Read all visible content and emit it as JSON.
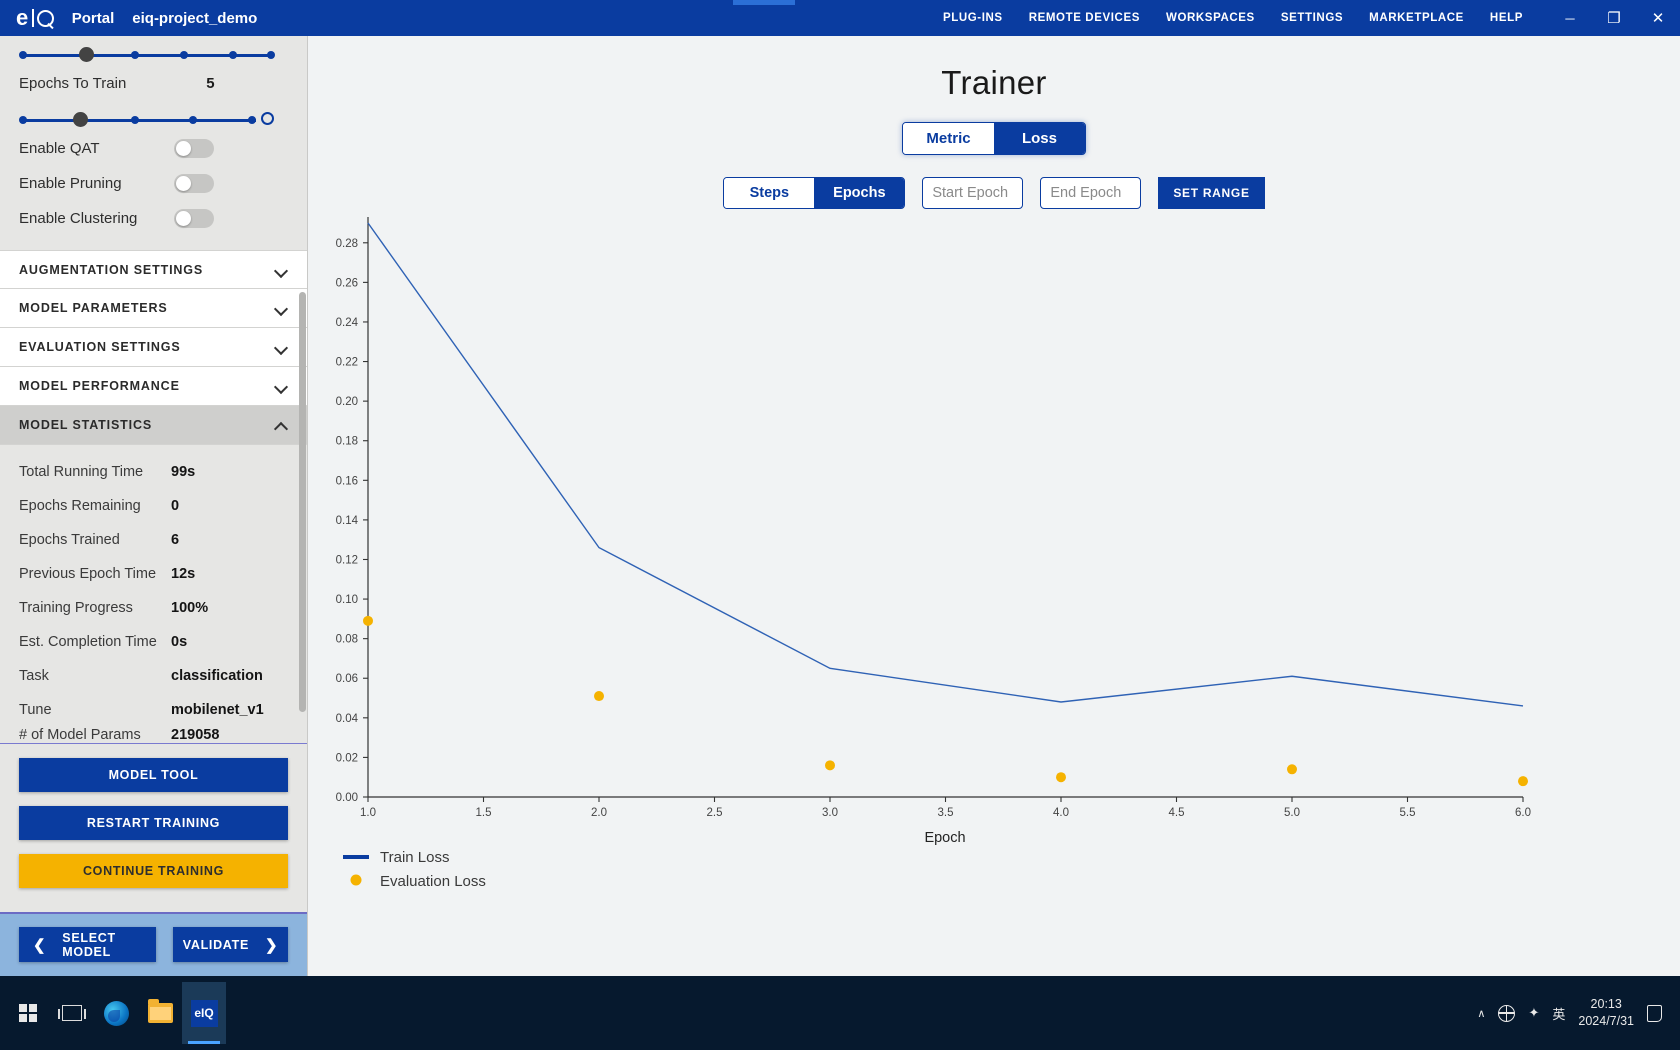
{
  "titlebar": {
    "logo": "eiq-logo",
    "portal_label": "Portal",
    "project_name": "eiq-project_demo",
    "nav": [
      {
        "label": "PLUG-INS"
      },
      {
        "label": "REMOTE DEVICES"
      },
      {
        "label": "WORKSPACES"
      },
      {
        "label": "SETTINGS"
      },
      {
        "label": "MARKETPLACE"
      },
      {
        "label": "HELP"
      }
    ],
    "window_controls": {
      "minimize": "─",
      "maximize": "❐",
      "close": "✕"
    }
  },
  "sidebar": {
    "epochs_to_train": {
      "label": "Epochs To Train",
      "value": "5"
    },
    "toggles": [
      {
        "label": "Enable QAT",
        "state": "off"
      },
      {
        "label": "Enable Pruning",
        "state": "off"
      },
      {
        "label": "Enable Clustering",
        "state": "off"
      }
    ],
    "accordions": [
      {
        "title": "AUGMENTATION SETTINGS",
        "expanded": false,
        "icon": "chevron-down-icon"
      },
      {
        "title": "MODEL PARAMETERS",
        "expanded": false,
        "icon": "chevron-down-icon"
      },
      {
        "title": "EVALUATION SETTINGS",
        "expanded": false,
        "icon": "chevron-down-icon"
      },
      {
        "title": "MODEL PERFORMANCE",
        "expanded": false,
        "icon": "chevron-down-icon"
      },
      {
        "title": "MODEL STATISTICS",
        "expanded": true,
        "icon": "chevron-up-icon"
      }
    ],
    "model_statistics": [
      {
        "key": "Total Running Time",
        "value": "99s"
      },
      {
        "key": "Epochs Remaining",
        "value": "0"
      },
      {
        "key": "Epochs Trained",
        "value": "6"
      },
      {
        "key": "Previous Epoch Time",
        "value": "12s"
      },
      {
        "key": "Training Progress",
        "value": "100%"
      },
      {
        "key": "Est. Completion Time",
        "value": "0s"
      },
      {
        "key": "Task",
        "value": "classification"
      },
      {
        "key": "Tune",
        "value": "mobilenet_v1"
      },
      {
        "key": "# of Model Params",
        "value": "219058"
      }
    ],
    "actions": [
      {
        "label": "MODEL TOOL",
        "style": "primary"
      },
      {
        "label": "RESTART TRAINING",
        "style": "primary"
      },
      {
        "label": "CONTINUE TRAINING",
        "style": "amber"
      }
    ],
    "footer": {
      "back_label": "SELECT MODEL",
      "back_icon": "chevron-left-icon",
      "next_label": "VALIDATE",
      "next_icon": "chevron-right-icon"
    }
  },
  "main": {
    "title": "Trainer",
    "metric_loss_toggle": {
      "options": [
        "Metric",
        "Loss"
      ],
      "selected": "Loss"
    },
    "steps_epochs_toggle": {
      "options": [
        "Steps",
        "Epochs"
      ],
      "selected": "Epochs"
    },
    "start_epoch_placeholder": "Start Epoch",
    "start_epoch_value": "",
    "end_epoch_placeholder": "End Epoch",
    "end_epoch_value": "",
    "set_range_label": "SET RANGE"
  },
  "colors": {
    "brand_blue": "#0a3ca0",
    "train_line": "#2f62b5",
    "eval_point": "#f5b200",
    "amber": "#f5b200",
    "panel_bg": "#e6e6e4",
    "content_bg": "#f1f3f4"
  },
  "chart_data": {
    "type": "line",
    "title": "",
    "xlabel": "Epoch",
    "ylabel": "",
    "xlim": [
      1.0,
      6.0
    ],
    "ylim": [
      0.0,
      0.29
    ],
    "xticks": [
      "1.0",
      "1.5",
      "2.0",
      "2.5",
      "3.0",
      "3.5",
      "4.0",
      "4.5",
      "5.0",
      "5.5",
      "6.0"
    ],
    "yticks": [
      "0.00",
      "0.02",
      "0.04",
      "0.06",
      "0.08",
      "0.10",
      "0.12",
      "0.14",
      "0.16",
      "0.18",
      "0.20",
      "0.22",
      "0.24",
      "0.26",
      "0.28"
    ],
    "grid": false,
    "legend_position": "bottom-left",
    "series": [
      {
        "name": "Train Loss",
        "marker": "line",
        "color": "#2f62b5",
        "x": [
          1.0,
          2.0,
          3.0,
          4.0,
          5.0,
          6.0
        ],
        "values": [
          0.29,
          0.126,
          0.065,
          0.048,
          0.061,
          0.046
        ]
      },
      {
        "name": "Evaluation Loss",
        "marker": "dot",
        "color": "#f5b200",
        "x": [
          1.0,
          2.0,
          3.0,
          4.0,
          5.0,
          6.0
        ],
        "values": [
          0.089,
          0.051,
          0.016,
          0.01,
          0.014,
          0.008
        ]
      }
    ]
  },
  "taskbar": {
    "icons": [
      {
        "name": "windows-start-icon"
      },
      {
        "name": "task-view-icon"
      },
      {
        "name": "edge-browser-icon"
      },
      {
        "name": "file-explorer-icon"
      },
      {
        "name": "eiq-portal-icon",
        "label": "eIQ",
        "active": true
      }
    ],
    "tray": {
      "chevron": "∧",
      "network": "globe-icon",
      "volume": "✦",
      "ime": "英",
      "time": "20:13",
      "date": "2024/7/31",
      "notifications": "notification-icon"
    }
  }
}
